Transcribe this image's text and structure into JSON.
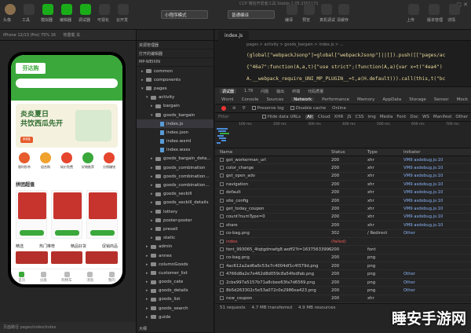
{
  "window": {
    "title": "CCP 微信开发者工具 Stable 1.05.2301171"
  },
  "toolbar": {
    "buttons": [
      {
        "label": "头像"
      },
      {
        "label": "工具"
      },
      {
        "label": "模拟器"
      },
      {
        "label": "编辑器"
      },
      {
        "label": "调试器"
      },
      {
        "label": "可视化"
      },
      {
        "label": "云开发"
      }
    ],
    "mode_select": "小程序模式",
    "compile_select": "普通编译",
    "actions": [
      {
        "label": "编译"
      },
      {
        "label": "预览"
      },
      {
        "label": "真机调试"
      },
      {
        "label": "清缓存"
      }
    ],
    "right_actions": [
      {
        "label": "上传"
      },
      {
        "label": "版本管理"
      },
      {
        "label": "详情"
      }
    ]
  },
  "simulator": {
    "device": "iPhone 12/13 (Pro) 75% 16",
    "mode": "热重载 关",
    "app": {
      "logo": "芬达购",
      "banner_line1": "炎炎夏日",
      "banner_line2": "共饮西瓜先开",
      "banner_badge": "¥49",
      "icons": [
        "限时秒杀",
        "组合购",
        "砍价免费",
        "好物推荐",
        "分销赚钱"
      ],
      "icon_colors": [
        "#e65c2e",
        "#f0a22e",
        "#e6452e",
        "#3aa83a",
        "#e6452e"
      ],
      "section_title": "拼团超值",
      "tabs": [
        "精选",
        "热门推荐",
        "精品好货",
        "促销商品"
      ],
      "nav": [
        "首页",
        "分类",
        "购物车",
        "消息",
        "我的"
      ]
    },
    "status_path": "页面路径 pages/index/index"
  },
  "tree": {
    "sections": [
      "资源管理器",
      "打开的编辑器",
      "MP-WEIXIN"
    ],
    "rows": [
      {
        "label": "common",
        "type": "folder",
        "depth": 1,
        "expanded": false
      },
      {
        "label": "components",
        "type": "folder",
        "depth": 1,
        "expanded": false
      },
      {
        "label": "pages",
        "type": "folder",
        "depth": 1,
        "expanded": true
      },
      {
        "label": "activity",
        "type": "folder",
        "depth": 2,
        "expanded": true
      },
      {
        "label": "bargain",
        "type": "folder",
        "depth": 3,
        "expanded": false
      },
      {
        "label": "goods_bargain",
        "type": "folder",
        "depth": 3,
        "expanded": true
      },
      {
        "label": "index.js",
        "type": "file",
        "depth": 4,
        "selected": true
      },
      {
        "label": "index.json",
        "type": "file",
        "depth": 4
      },
      {
        "label": "index.wxml",
        "type": "file",
        "depth": 4
      },
      {
        "label": "index.wxss",
        "type": "file",
        "depth": 4
      },
      {
        "label": "goods_bargain_deta...",
        "type": "folder",
        "depth": 3,
        "expanded": false
      },
      {
        "label": "goods_combination",
        "type": "folder",
        "depth": 3,
        "expanded": false
      },
      {
        "label": "goods_combination...",
        "type": "folder",
        "depth": 3,
        "expanded": false
      },
      {
        "label": "goods_combination...",
        "type": "folder",
        "depth": 3,
        "expanded": false
      },
      {
        "label": "goods_seckill",
        "type": "folder",
        "depth": 3,
        "expanded": false
      },
      {
        "label": "goods_seckill_details",
        "type": "folder",
        "depth": 3,
        "expanded": false
      },
      {
        "label": "lottery",
        "type": "folder",
        "depth": 3,
        "expanded": false
      },
      {
        "label": "poster-poster",
        "type": "folder",
        "depth": 3,
        "expanded": false
      },
      {
        "label": "presell",
        "type": "folder",
        "depth": 3,
        "expanded": false
      },
      {
        "label": "static",
        "type": "folder",
        "depth": 3,
        "expanded": false
      },
      {
        "label": "admin",
        "type": "folder",
        "depth": 2,
        "expanded": false
      },
      {
        "label": "annex",
        "type": "folder",
        "depth": 2,
        "expanded": false
      },
      {
        "label": "columnGoods",
        "type": "folder",
        "depth": 2,
        "expanded": false
      },
      {
        "label": "customer_list",
        "type": "folder",
        "depth": 2,
        "expanded": false
      },
      {
        "label": "goods_cate",
        "type": "folder",
        "depth": 2,
        "expanded": false
      },
      {
        "label": "goods_details",
        "type": "folder",
        "depth": 2,
        "expanded": false
      },
      {
        "label": "goods_list",
        "type": "folder",
        "depth": 2,
        "expanded": false
      },
      {
        "label": "goods_search",
        "type": "folder",
        "depth": 2,
        "expanded": false
      },
      {
        "label": "guide",
        "type": "folder",
        "depth": 2,
        "expanded": false
      }
    ],
    "footer": "大纲"
  },
  "editor": {
    "tab": "index.js",
    "breadcrumb": "pages > activity > goods_bargain > index.js > ...",
    "code": [
      "(global[\"webpackJsonp\"]=global[\"webpackJsonp\"]||[]).push([[\"pages/ac",
      "{\"46a7\":function(A,a,t){\"use strict\";(function(A,a){var x=t(\"4ea4\")",
      "A.__webpack_require_UNI_MP_PLUGIN__=t,a(H.default))).call(this,t(\"bc"
    ]
  },
  "devtools": {
    "top_tabs": [
      "调试器",
      "1.78",
      "问题",
      "输出",
      "终端",
      "代码质量"
    ],
    "tabs": [
      "Wxml",
      "Console",
      "Sources",
      "Network",
      "Performance",
      "Memory",
      "AppData",
      "Storage",
      "Sensor",
      "Mock"
    ],
    "active_tab": "Network",
    "toolbar": {
      "preserve_log": "Preserve log",
      "disable_cache": "Disable cache",
      "throttle": "Online"
    },
    "filter": {
      "placeholder": "Filter",
      "hide_data_urls": "Hide data URLs",
      "types": [
        "All",
        "Cloud",
        "XHR",
        "JS",
        "CSS",
        "Img",
        "Media",
        "Font",
        "Doc",
        "WS",
        "Manifest",
        "Other"
      ],
      "active_type": "All"
    },
    "timeline_ticks": [
      "100 ms",
      "200 ms",
      "300 ms",
      "400 ms",
      "500 ms",
      "600 ms",
      "700 ms"
    ],
    "columns": {
      "name": "Name",
      "status": "Status",
      "type": "Type",
      "initiator": "Initiator"
    },
    "requests": [
      {
        "name": "get_workerman_url",
        "status": "200",
        "type": "xhr",
        "initiator": "VM9 asdebug.js:10",
        "error": false
      },
      {
        "name": "color_change",
        "status": "200",
        "type": "xhr",
        "initiator": "VM9 asdebug.js:10",
        "error": false
      },
      {
        "name": "get_open_adv",
        "status": "200",
        "type": "xhr",
        "initiator": "VM9 asdebug.js:10",
        "error": false
      },
      {
        "name": "navigation",
        "status": "200",
        "type": "xhr",
        "initiator": "VM9 asdebug.js:10",
        "error": false
      },
      {
        "name": "default",
        "status": "200",
        "type": "xhr",
        "initiator": "VM9 asdebug.js:10",
        "error": false
      },
      {
        "name": "site_config",
        "status": "200",
        "type": "xhr",
        "initiator": "VM9 asdebug.js:10",
        "error": false
      },
      {
        "name": "get_today_coupon",
        "status": "200",
        "type": "xhr",
        "initiator": "VM9 asdebug.js:10",
        "error": false
      },
      {
        "name": "count?numType=0",
        "status": "200",
        "type": "xhr",
        "initiator": "VM9 asdebug.js:10",
        "error": false
      },
      {
        "name": "share",
        "status": "200",
        "type": "xhr",
        "initiator": "VM9 asdebug.js:10",
        "error": false
      },
      {
        "name": "co-bag.png",
        "status": "302",
        "type": "/ Redirect",
        "initiator": "Other",
        "error": false
      },
      {
        "name": "index",
        "status": "(failed)",
        "type": "",
        "initiator": "",
        "error": true
      },
      {
        "name": "font_993065_4tqtgdmwfg8.woff2?t=1637563399670",
        "status": "200",
        "type": "font",
        "initiator": "",
        "error": false
      },
      {
        "name": "co-bag.png",
        "status": "200",
        "type": "png",
        "initiator": "",
        "error": false
      },
      {
        "name": "4ac612a2ad6a6c53e7c4004df1c4f379d.png",
        "status": "200",
        "type": "png",
        "initiator": "",
        "error": false
      },
      {
        "name": "4766d8a2e7e462d8d059c8a54fedfab.png",
        "status": "200",
        "type": "png",
        "initiator": "Other",
        "error": false
      },
      {
        "name": "2cbe997a5157b71a8cbee63fa7d6569.png",
        "status": "200",
        "type": "png",
        "initiator": "Other",
        "error": false
      },
      {
        "name": "8b5d263302c5e53a072c0e2986ea423.png",
        "status": "200",
        "type": "png",
        "initiator": "Other",
        "error": false
      },
      {
        "name": "new_coupon",
        "status": "200",
        "type": "xhr",
        "initiator": "",
        "error": false
      }
    ],
    "status_bar": [
      "51 requests",
      "4.7 MB transferred",
      "4.9 MB resources"
    ]
  },
  "watermark": "睡安手游网"
}
